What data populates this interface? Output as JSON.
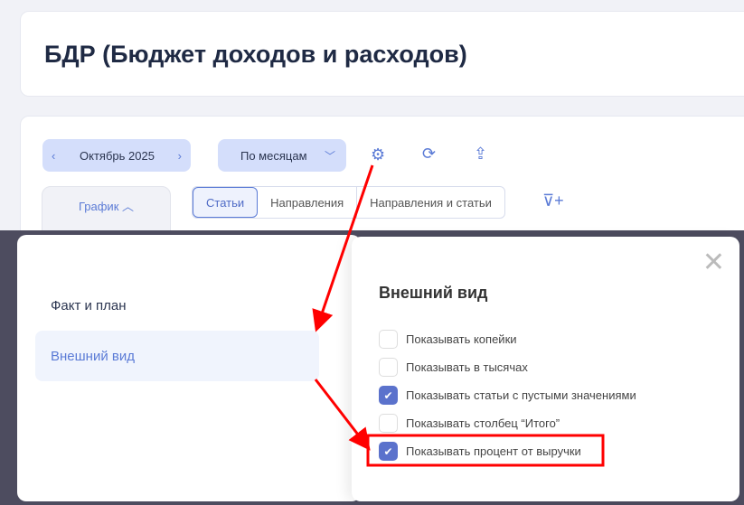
{
  "page": {
    "title": "БДР (Бюджет доходов и расходов)"
  },
  "toolbar": {
    "period": "Октябрь 2025",
    "grouping": "По месяцам",
    "view_toggle": "График",
    "tabs": [
      {
        "label": "Статьи",
        "active": true
      },
      {
        "label": "Направления",
        "active": false
      },
      {
        "label": "Направления и статьи",
        "active": false
      }
    ]
  },
  "modal": {
    "menu": [
      {
        "label": "Факт и план",
        "selected": false
      },
      {
        "label": "Внешний вид",
        "selected": true
      }
    ],
    "section_title": "Внешний вид",
    "options": [
      {
        "label": "Показывать копейки",
        "checked": false
      },
      {
        "label": "Показывать в тысячах",
        "checked": false
      },
      {
        "label": "Показывать статьи с пустыми значениями",
        "checked": true
      },
      {
        "label": "Показывать столбец “Итого”",
        "checked": false
      },
      {
        "label": "Показывать процент от выручки",
        "checked": true
      }
    ]
  },
  "colors": {
    "accent": "#5b72cc",
    "annotation": "#ff0000"
  }
}
